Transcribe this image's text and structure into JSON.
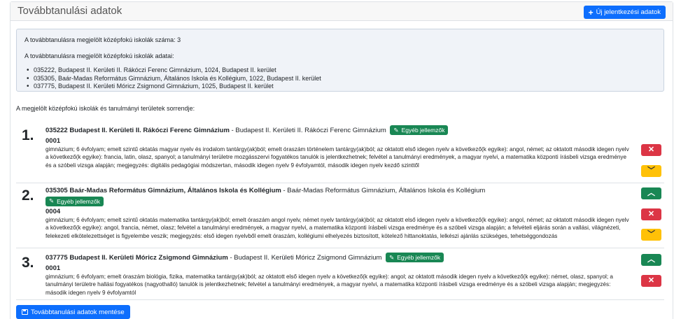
{
  "header": {
    "title": "Továbbtanulási adatok",
    "new_button": "Új jelentkezési adatok"
  },
  "info": {
    "count_text": "A továbbtanulásra megjelölt középfokú iskolák száma: 3",
    "list_title": "A továbbtanulásra megjelölt középfokú iskolák adatai:",
    "schools": [
      "035222, Budapest II. Kerületi II. Rákóczi Ferenc Gimnázium, 1024, Budapest II. kerület",
      "035305, Baár-Madas Református Gimnázium, Általános Iskola és Kollégium, 1022, Budapest II. kerület",
      "037775, Budapest II. Kerületi Móricz Zsigmond Gimnázium, 1025, Budapest II. kerület"
    ]
  },
  "order_label": "A megjelölt középfokú iskolák és tanulmányi területek sorrendje:",
  "other_button": "Egyéb jellemzők",
  "choices": [
    {
      "rank": "1.",
      "name": "035222 Budapest II. Kerületi II. Rákóczi Ferenc Gimnázium",
      "suffix": "- Budapest II. Kerületi II. Rákóczi Ferenc Gimnázium",
      "code": "0001",
      "description": "gimnázium; 6 évfolyam; emelt szintű oktatás magyar nyelv és irodalom tantárgy(ak)ból; emelt óraszám történelem tantárgy(ak)ból; az oktatott első idegen nyelv a következő(k egyike): angol, német; az oktatott második idegen nyelv a következő(k egyike): francia, latin, olasz, spanyol; a tanulmányi területre mozgásszervi fogyatékos tanulók is jelentkezhetnek; felvétel a tanulmányi eredmények, a magyar nyelvi, a matematika központi írásbeli vizsga eredménye és a szóbeli vizsga alapján; megjegyzés: digitális pedagógiai módszertan, második idegen nyelv 9 évfolyamtól, második idegen nyelv kezdő szinttől"
    },
    {
      "rank": "2.",
      "name": "035305 Baár-Madas Református Gimnázium, Általános Iskola és Kollégium",
      "suffix": "- Baár-Madas Református Gimnázium, Általános Iskola és Kollégium",
      "code": "0004",
      "description": "gimnázium; 6 évfolyam; emelt szintű oktatás matematika tantárgy(ak)ból; emelt óraszám angol nyelv, német nyelv tantárgy(ak)ból; az oktatott első idegen nyelv a következő(k egyike): angol, német; az oktatott második idegen nyelv a következő(k egyike): angol, francia, német, olasz; felvétel a tanulmányi eredmények, a magyar nyelvi, a matematika központi írásbeli vizsga eredménye és a szóbeli vizsga alapján; a felvételi eljárás során a vallási, világnézeti, felekezeti elkötelezettséget is figyelembe veszik; megjegyzés: első idegen nyelvből emelt óraszám, kollégiumi elhelyezés biztosított, kötelező hittanoktatás, lelkészi ajánlás szükséges, tehetséggondozás"
    },
    {
      "rank": "3.",
      "name": "037775 Budapest II. Kerületi Móricz Zsigmond Gimnázium",
      "suffix": "- Budapest II. Kerületi Móricz Zsigmond Gimnázium",
      "code": "0001",
      "description": "gimnázium; 6 évfolyam; emelt óraszám biológia, fizika, matematika tantárgy(ak)ból; az oktatott első idegen nyelv a következő(k egyike): angol; az oktatott második idegen nyelv a következő(k egyike): német, olasz, spanyol; a tanulmányi területre hallási fogyatékos (nagyothalló) tanulók is jelentkezhetnek; felvétel a tanulmányi eredmények, a magyar nyelvi, a matematika központi írásbeli vizsga eredménye és a szóbeli vizsga alapján; megjegyzés: második idegen nyelv 9 évfolyamtól"
    }
  ],
  "save_button": "Továbbtanulási adatok mentése",
  "icons": {
    "plus": "+",
    "edit": "✎",
    "remove": "✕",
    "up": "︿",
    "down": "﹀"
  },
  "colors": {
    "primary": "#0d6efd",
    "success": "#198754",
    "danger": "#dc3545",
    "warning": "#ffc107"
  }
}
